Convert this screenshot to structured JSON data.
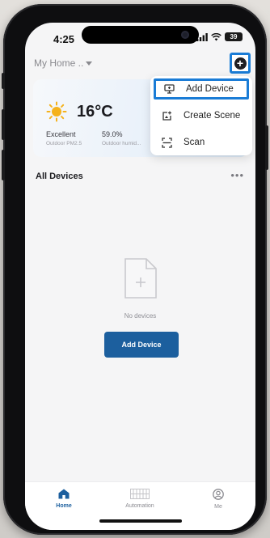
{
  "status_bar": {
    "time": "4:25",
    "battery": "39"
  },
  "header": {
    "home_name": "My Home ..",
    "add_icon": "plus-circle-icon"
  },
  "weather": {
    "temperature": "16°C",
    "air_quality_value": "Excellent",
    "air_quality_label": "Outdoor PM2.5",
    "humidity_value": "59.0%",
    "humidity_label": "Outdoor humid...",
    "icon": "sun-icon"
  },
  "dropdown_menu": {
    "items": [
      {
        "label": "Add Device",
        "icon": "add-device-icon",
        "selected": true
      },
      {
        "label": "Create Scene",
        "icon": "create-scene-icon",
        "selected": false
      },
      {
        "label": "Scan",
        "icon": "scan-icon",
        "selected": false
      }
    ]
  },
  "devices": {
    "section_title": "All Devices",
    "empty_message": "No devices",
    "add_button_label": "Add Device"
  },
  "tab_bar": {
    "tabs": [
      {
        "label": "Home",
        "icon": "home-icon",
        "active": true
      },
      {
        "label": "Automation",
        "icon": "automation-icon",
        "active": false
      },
      {
        "label": "Me",
        "icon": "profile-icon",
        "active": false
      }
    ]
  },
  "colors": {
    "accent": "#1c5f9e",
    "highlight": "#1a7cd6"
  }
}
